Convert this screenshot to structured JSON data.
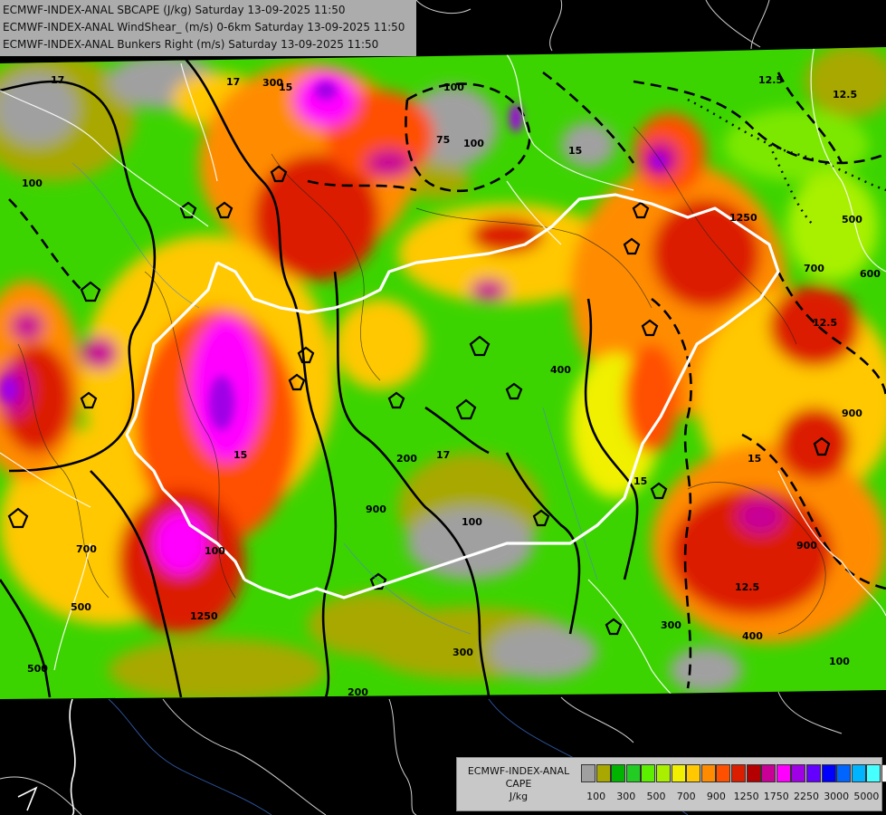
{
  "header": {
    "line1": "ECMWF-INDEX-ANAL SBCAPE (J/kg) Saturday 13-09-2025 11:50",
    "line2": "ECMWF-INDEX-ANAL WindShear_ (m/s) 0-6km Saturday 13-09-2025 11:50",
    "line3": "ECMWF-INDEX-ANAL Bunkers Right (m/s) Saturday 13-09-2025 11:50"
  },
  "legend": {
    "title_line1": "ECMWF-INDEX-ANAL",
    "title_line2": "CAPE",
    "title_line3": "J/kg",
    "colors": [
      "#a0a0a0",
      "#a8a800",
      "#00b400",
      "#22cc22",
      "#5cf000",
      "#a8f000",
      "#f0f000",
      "#ffc800",
      "#ff8c00",
      "#ff5000",
      "#dc1e00",
      "#b40000",
      "#c80096",
      "#ff00ff",
      "#a000e6",
      "#6400ff",
      "#0000ff",
      "#0064ff",
      "#00b4ff",
      "#46ffff",
      "#ffffff"
    ],
    "labels": [
      {
        "text": "100",
        "index": 1
      },
      {
        "text": "300",
        "index": 3
      },
      {
        "text": "500",
        "index": 5
      },
      {
        "text": "700",
        "index": 7
      },
      {
        "text": "900",
        "index": 9
      },
      {
        "text": "1250",
        "index": 11
      },
      {
        "text": "1750",
        "index": 13
      },
      {
        "text": "2250",
        "index": 15
      },
      {
        "text": "3000",
        "index": 17
      },
      {
        "text": "5000",
        "index": 19
      }
    ]
  },
  "contour_labels": [
    "17",
    "100",
    "15",
    "17",
    "100",
    "300",
    "75",
    "100",
    "15",
    "12.5",
    "12.5",
    "500",
    "700",
    "900",
    "1250",
    "600",
    "12.5",
    "15",
    "900",
    "17",
    "100",
    "200",
    "300",
    "200",
    "15",
    "500",
    "1250",
    "12.5",
    "400",
    "15",
    "900",
    "300",
    "100",
    "400",
    "100",
    "500",
    "700"
  ]
}
